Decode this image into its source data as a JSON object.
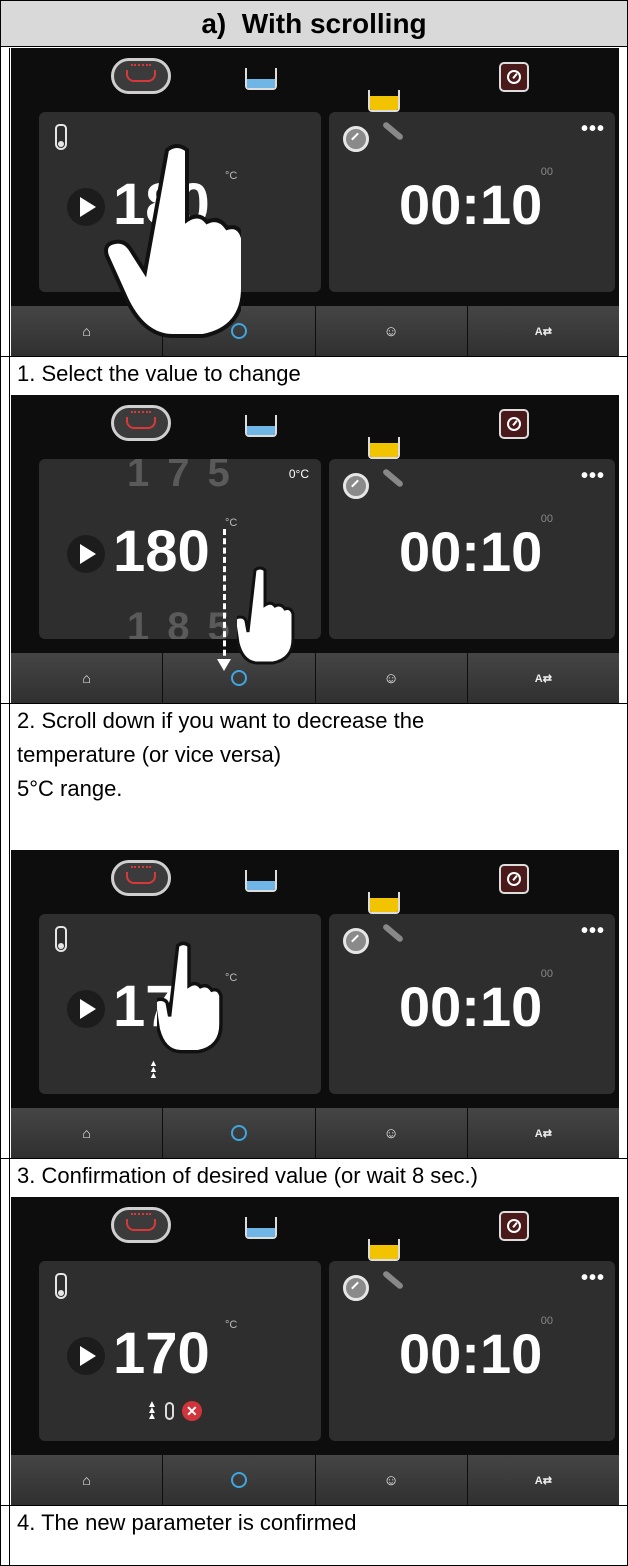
{
  "title": "a)  With scrolling",
  "steps": [
    {
      "caption": [
        "1. Select the value to change"
      ],
      "temp": "180",
      "unit": "°C",
      "timer": "00:10",
      "secs": "00",
      "ghost_top": "",
      "ghost_bottom": "",
      "setpoint": ""
    },
    {
      "caption": [
        "2. Scroll down if you want to decrease the",
        "temperature (or vice versa)",
        "5°C range."
      ],
      "temp": "180",
      "unit": "°C",
      "timer": "00:10",
      "secs": "00",
      "ghost_top": "175",
      "ghost_bottom": "185",
      "setpoint": "0°C"
    },
    {
      "caption": [
        "3. Confirmation of desired value (or wait 8 sec.)"
      ],
      "temp": "170",
      "unit": "°C",
      "timer": "00:10",
      "secs": "00",
      "ghost_top": "",
      "ghost_bottom": "",
      "setpoint": ""
    },
    {
      "caption": [
        "4. The new parameter is confirmed"
      ],
      "temp": "170",
      "unit": "°C",
      "timer": "00:10",
      "secs": "00",
      "ghost_top": "",
      "ghost_bottom": "",
      "setpoint": "",
      "status_x": "✕"
    }
  ],
  "icons": {
    "top": [
      "grill-mode-icon",
      "water-bath-icon",
      "oil-bath-icon",
      "oven-mode-icon"
    ],
    "nav": [
      "home-icon",
      "rinse-icon",
      "chef-icon",
      "language-icon"
    ],
    "more": "•••"
  },
  "colors": {
    "screen_bg": "#0d0d0d",
    "panel_bg": "#2e2e2e",
    "accent_red": "#d9383a",
    "water_blue": "#6fb6e6",
    "oil_yellow": "#f2c400"
  }
}
